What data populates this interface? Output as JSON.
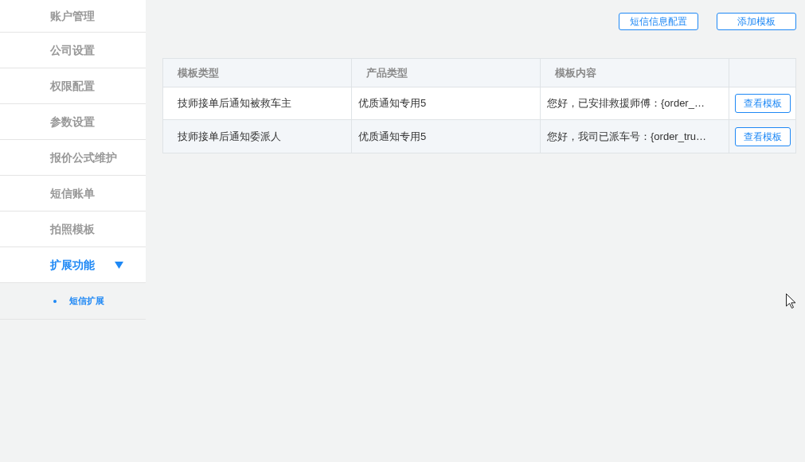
{
  "sidebar": {
    "items": [
      {
        "label": "账户管理",
        "selected": false
      },
      {
        "label": "公司设置",
        "selected": false
      },
      {
        "label": "权限配置",
        "selected": false
      },
      {
        "label": "参数设置",
        "selected": false
      },
      {
        "label": "报价公式维护",
        "selected": false
      },
      {
        "label": "短信账单",
        "selected": false
      },
      {
        "label": "拍照模板",
        "selected": false
      },
      {
        "label": "扩展功能",
        "selected": true,
        "expanded": true,
        "children": [
          {
            "label": "短信扩展",
            "selected": true
          }
        ]
      }
    ]
  },
  "toolbar": {
    "buttons": [
      "短信信息配置",
      "添加模板"
    ]
  },
  "table": {
    "columns": [
      "模板类型",
      "产品类型",
      "模板内容"
    ],
    "rows": [
      {
        "cells": [
          "技师接单后通知被救车主",
          "优质通知专用5",
          "您好，已安排救援师傅：{order_…"
        ],
        "action": "查看模板"
      },
      {
        "cells": [
          "技师接单后通知委派人",
          "优质通知专用5",
          "您好，我司已派车号：{order_tru…"
        ],
        "action": "查看模板"
      }
    ]
  }
}
